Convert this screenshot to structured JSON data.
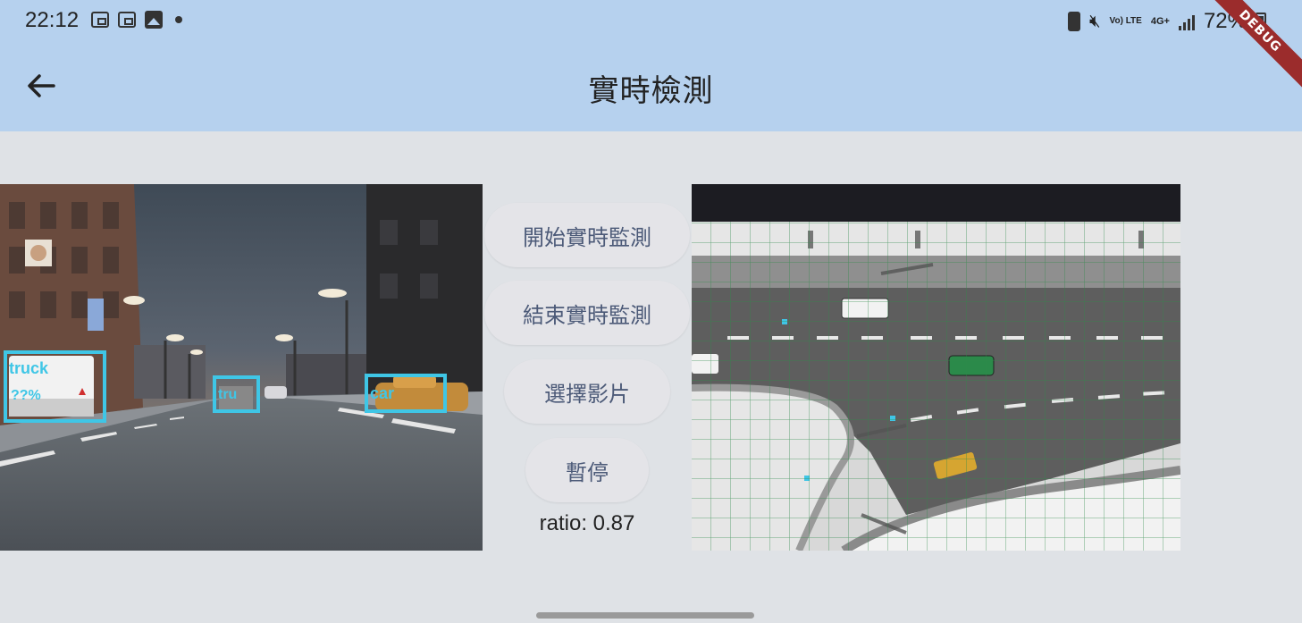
{
  "status_bar": {
    "time": "22:12",
    "battery_percent": "72%",
    "network": "4G+",
    "volte": "Vo) LTE",
    "left_icons": [
      "screenshot-icon",
      "screenshot-icon",
      "gallery-icon",
      "notification-dot-icon"
    ],
    "right_icons": [
      "battery-saver-icon",
      "mute-icon",
      "volte-icon",
      "4g-icon",
      "signal-icon",
      "battery-icon"
    ]
  },
  "app_bar": {
    "title": "實時檢測",
    "back_icon": "arrow-back-icon",
    "debug_banner": "DEBUG"
  },
  "camera_view": {
    "detections": [
      {
        "label": "truck",
        "score": "??%"
      },
      {
        "label": "tru",
        "score": ""
      },
      {
        "label": "car",
        "score": ""
      }
    ]
  },
  "controls": {
    "start_label": "開始實時監測",
    "stop_label": "結束實時監測",
    "select_label": "選擇影片",
    "pause_label": "暫停",
    "ratio_text": "ratio: 0.87"
  },
  "colors": {
    "app_bar": "#b6d1ee",
    "background": "#dfe2e6",
    "detection_box": "#3fc6e6",
    "button_text": "#4c5a78"
  }
}
